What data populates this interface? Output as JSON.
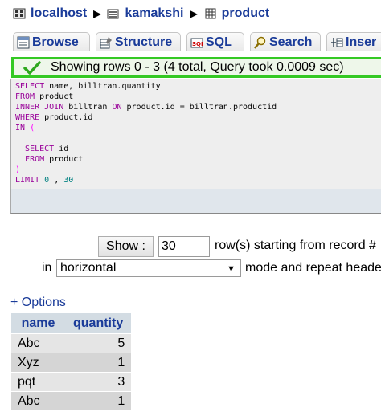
{
  "breadcrumb": {
    "server": "localhost",
    "database": "kamakshi",
    "table": "product"
  },
  "tabs": [
    {
      "label": "Browse",
      "icon": "browse-icon"
    },
    {
      "label": "Structure",
      "icon": "structure-icon"
    },
    {
      "label": "SQL",
      "icon": "sql-icon"
    },
    {
      "label": "Search",
      "icon": "search-icon"
    },
    {
      "label": "Inser",
      "icon": "insert-icon"
    }
  ],
  "success_message": "Showing rows 0 - 3 (4 total, Query took 0.0009 sec)",
  "query_lines": [
    "SELECT name, billtran.quantity",
    "FROM product",
    "INNER JOIN billtran ON product.id = billtran.productid",
    "WHERE product.id",
    "IN (",
    "",
    "  SELECT id",
    "  FROM product",
    ")",
    "LIMIT 0 , 30"
  ],
  "navigation": {
    "show_button": "Show :",
    "rows_value": "30",
    "starting_label": "row(s) starting from record #",
    "in_label": "in",
    "mode_value": "horizontal",
    "mode_label": "mode and repeat heade"
  },
  "options_link": "+ Options",
  "results": {
    "columns": [
      "name",
      "quantity"
    ],
    "rows": [
      [
        "Abc",
        "5"
      ],
      [
        "Xyz",
        "1"
      ],
      [
        "pqt",
        "3"
      ],
      [
        "Abc",
        "1"
      ]
    ]
  },
  "colors": {
    "link": "#1a3b99",
    "success_border": "#34c924",
    "header_bg": "#d3dce3"
  }
}
